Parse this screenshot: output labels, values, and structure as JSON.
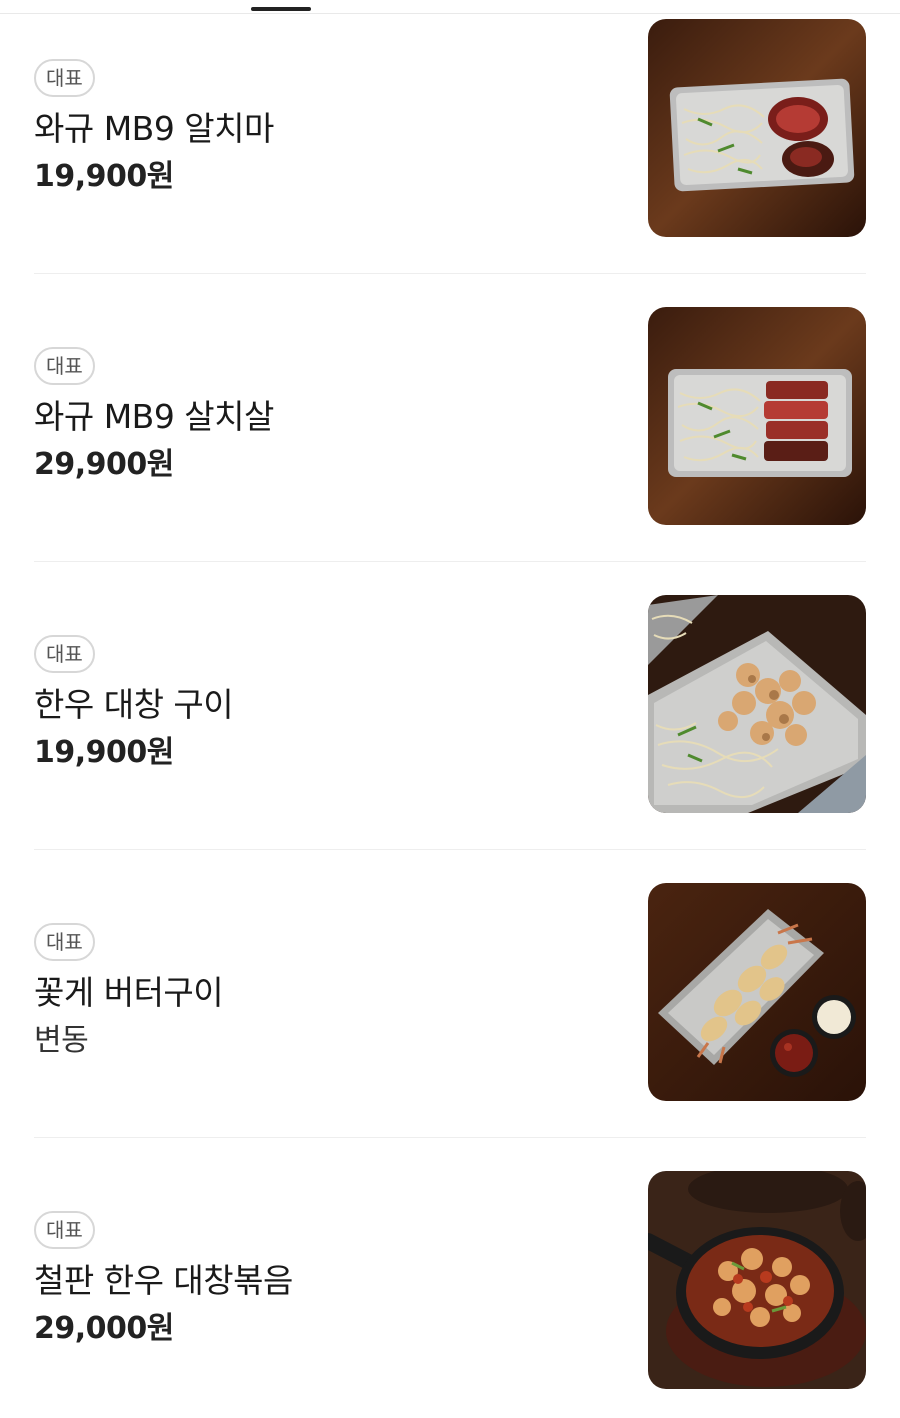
{
  "menu": {
    "items": [
      {
        "badge": "대표",
        "name": "와규 MB9 알치마",
        "price": "19,900원",
        "image": "steak-plate-image"
      },
      {
        "badge": "대표",
        "name": "와규 MB9 살치살",
        "price": "29,900원",
        "image": "steak-plate-image"
      },
      {
        "badge": "대표",
        "name": "한우 대창 구이",
        "price": "19,900원",
        "image": "grilled-intestine-image"
      },
      {
        "badge": "대표",
        "name": "꽃게 버터구이",
        "price": "변동",
        "image": "butter-crab-image"
      },
      {
        "badge": "대표",
        "name": "철판 한우 대창볶음",
        "price": "29,000원",
        "image": "stir-fry-skillet-image"
      }
    ]
  },
  "colors": {
    "badge_border": "#d7d7d7",
    "divider": "#eeeeee",
    "text": "#1a1a1a"
  }
}
